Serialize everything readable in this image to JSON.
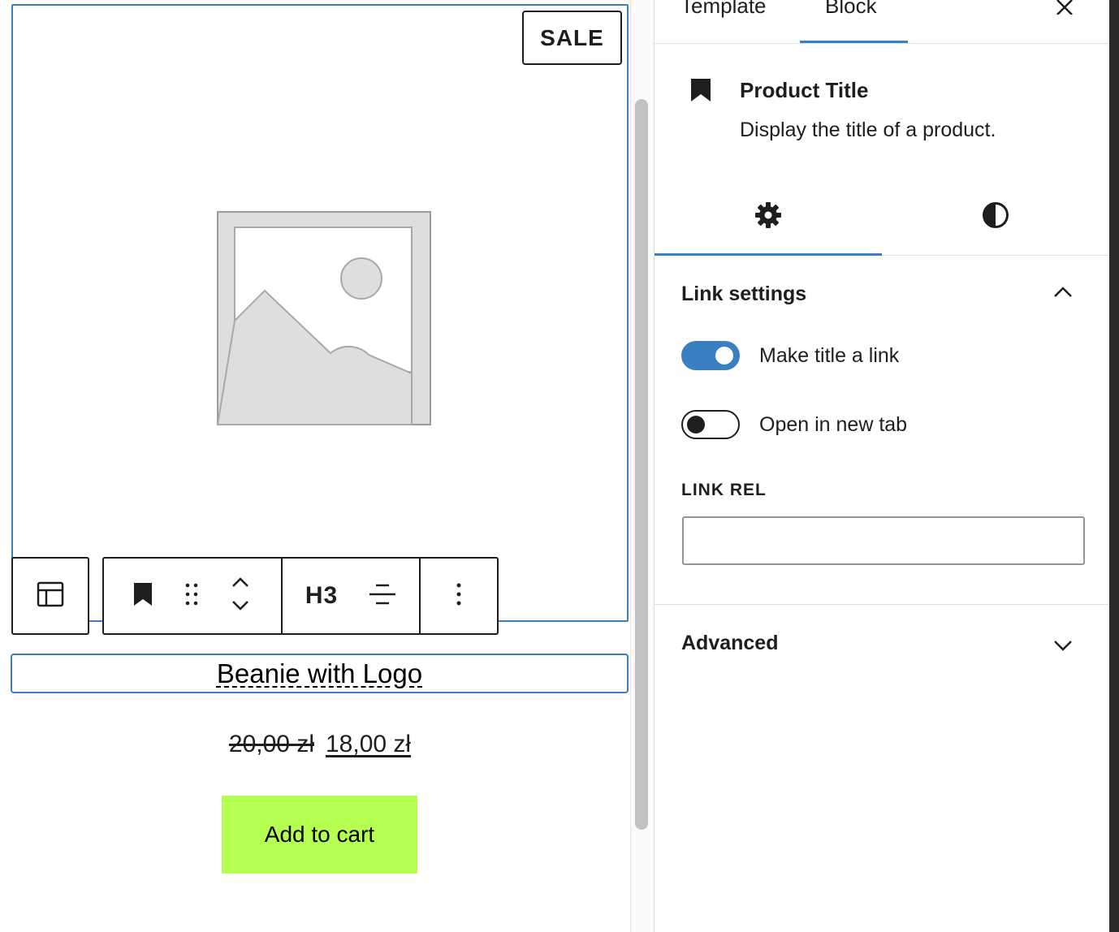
{
  "canvas": {
    "sale_badge": "SALE",
    "image_placeholder": "image-placeholder-icon",
    "toolbar": {
      "parent_icon": "layout-template-icon",
      "block_icon": "bookmark-icon",
      "drag_icon": "drag-handle-icon",
      "move_up_icon": "chevron-up-icon",
      "move_down_icon": "chevron-down-icon",
      "heading_level": "H3",
      "align_icon": "align-center-icon",
      "more_icon": "more-vertical-icon"
    },
    "product_title": "Beanie with Logo",
    "price_old": "20,00 zł",
    "price_new": "18,00 zł",
    "add_to_cart": "Add to cart",
    "add_to_cart_color": "#b5ff50",
    "selection_color": "#3a7fc1"
  },
  "sidebar": {
    "tabs": [
      "Template",
      "Block"
    ],
    "active_tab": "Block",
    "close_icon": "close-icon",
    "block_card": {
      "icon": "bookmark-icon",
      "title": "Product Title",
      "description": "Display the title of a product."
    },
    "sub_tabs": [
      "settings-gear-icon",
      "styles-contrast-icon"
    ],
    "link_settings": {
      "heading": "Link settings",
      "expanded": true,
      "toggles": [
        {
          "label": "Make title a link",
          "on": true
        },
        {
          "label": "Open in new tab",
          "on": false
        }
      ],
      "link_rel_label": "LINK REL",
      "link_rel_value": ""
    },
    "advanced": {
      "heading": "Advanced",
      "expanded": false
    },
    "accent_color": "#3a7fc1"
  }
}
